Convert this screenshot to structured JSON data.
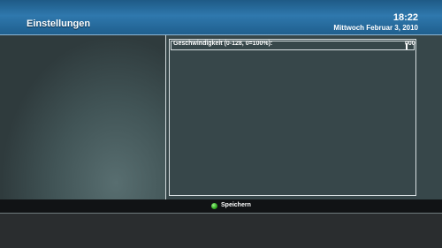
{
  "header": {
    "title": "Einstellungen",
    "time": "18:22",
    "date": "Mittwoch Februar 3, 2010"
  },
  "setting": {
    "label": "Geschwindigkeit (0-128, 0=100%):",
    "value": "000"
  },
  "footer": {
    "save_label": "Speichern",
    "save_color": "#35b026"
  },
  "colors": {
    "header_blue": "#2f78ad",
    "panel": "#37474a"
  }
}
